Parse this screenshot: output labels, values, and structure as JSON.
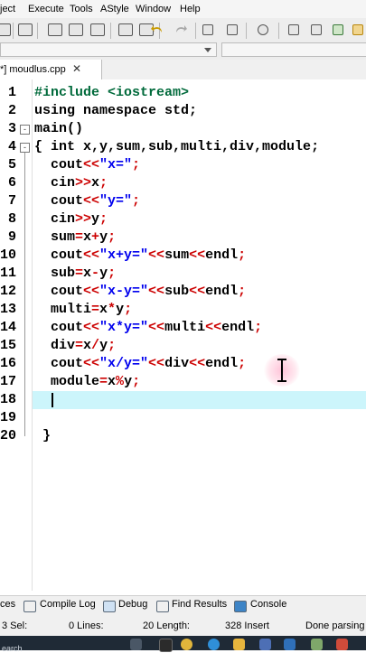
{
  "menu": {
    "items": [
      "ject",
      "Execute",
      "Tools",
      "AStyle",
      "Window",
      "Help"
    ]
  },
  "tab": {
    "label": "*] moudlus.cpp",
    "close": "✕"
  },
  "editor": {
    "line_numbers": [
      "1",
      "2",
      "3",
      "4",
      "5",
      "6",
      "7",
      "8",
      "9",
      "10",
      "11",
      "12",
      "13",
      "14",
      "15",
      "16",
      "17",
      "18",
      "19",
      "20"
    ],
    "lines": [
      [
        {
          "t": "#include <iostream>",
          "c": "pp"
        }
      ],
      [
        {
          "t": "using namespace std;",
          "c": "k"
        }
      ],
      [
        {
          "t": "main()",
          "c": "k"
        }
      ],
      [
        {
          "t": "{ ",
          "c": "k"
        },
        {
          "t": "int x,y,sum,sub,multi,div,module;",
          "c": "k"
        }
      ],
      [
        {
          "t": "  cout",
          "c": "k"
        },
        {
          "t": "<<",
          "c": "o"
        },
        {
          "t": "\"x=\"",
          "c": "s"
        },
        {
          "t": ";",
          "c": "o"
        }
      ],
      [
        {
          "t": "  cin",
          "c": "k"
        },
        {
          "t": ">>",
          "c": "o"
        },
        {
          "t": "x",
          "c": "k"
        },
        {
          "t": ";",
          "c": "o"
        }
      ],
      [
        {
          "t": "  cout",
          "c": "k"
        },
        {
          "t": "<<",
          "c": "o"
        },
        {
          "t": "\"y=\"",
          "c": "s"
        },
        {
          "t": ";",
          "c": "o"
        }
      ],
      [
        {
          "t": "  cin",
          "c": "k"
        },
        {
          "t": ">>",
          "c": "o"
        },
        {
          "t": "y",
          "c": "k"
        },
        {
          "t": ";",
          "c": "o"
        }
      ],
      [
        {
          "t": "  sum",
          "c": "k"
        },
        {
          "t": "=",
          "c": "o"
        },
        {
          "t": "x",
          "c": "k"
        },
        {
          "t": "+",
          "c": "o"
        },
        {
          "t": "y",
          "c": "k"
        },
        {
          "t": ";",
          "c": "o"
        }
      ],
      [
        {
          "t": "  cout",
          "c": "k"
        },
        {
          "t": "<<",
          "c": "o"
        },
        {
          "t": "\"x+y=\"",
          "c": "s"
        },
        {
          "t": "<<",
          "c": "o"
        },
        {
          "t": "sum",
          "c": "k"
        },
        {
          "t": "<<",
          "c": "o"
        },
        {
          "t": "endl",
          "c": "k"
        },
        {
          "t": ";",
          "c": "o"
        }
      ],
      [
        {
          "t": "  sub",
          "c": "k"
        },
        {
          "t": "=",
          "c": "o"
        },
        {
          "t": "x",
          "c": "k"
        },
        {
          "t": "-",
          "c": "o"
        },
        {
          "t": "y",
          "c": "k"
        },
        {
          "t": ";",
          "c": "o"
        }
      ],
      [
        {
          "t": "  cout",
          "c": "k"
        },
        {
          "t": "<<",
          "c": "o"
        },
        {
          "t": "\"x-y=\"",
          "c": "s"
        },
        {
          "t": "<<",
          "c": "o"
        },
        {
          "t": "sub",
          "c": "k"
        },
        {
          "t": "<<",
          "c": "o"
        },
        {
          "t": "endl",
          "c": "k"
        },
        {
          "t": ";",
          "c": "o"
        }
      ],
      [
        {
          "t": "  multi",
          "c": "k"
        },
        {
          "t": "=",
          "c": "o"
        },
        {
          "t": "x",
          "c": "k"
        },
        {
          "t": "*",
          "c": "o"
        },
        {
          "t": "y",
          "c": "k"
        },
        {
          "t": ";",
          "c": "o"
        }
      ],
      [
        {
          "t": "  cout",
          "c": "k"
        },
        {
          "t": "<<",
          "c": "o"
        },
        {
          "t": "\"x*y=\"",
          "c": "s"
        },
        {
          "t": "<<",
          "c": "o"
        },
        {
          "t": "multi",
          "c": "k"
        },
        {
          "t": "<<",
          "c": "o"
        },
        {
          "t": "endl",
          "c": "k"
        },
        {
          "t": ";",
          "c": "o"
        }
      ],
      [
        {
          "t": "  div",
          "c": "k"
        },
        {
          "t": "=",
          "c": "o"
        },
        {
          "t": "x",
          "c": "k"
        },
        {
          "t": "/",
          "c": "o"
        },
        {
          "t": "y",
          "c": "k"
        },
        {
          "t": ";",
          "c": "o"
        }
      ],
      [
        {
          "t": "  cout",
          "c": "k"
        },
        {
          "t": "<<",
          "c": "o"
        },
        {
          "t": "\"x/y=\"",
          "c": "s"
        },
        {
          "t": "<<",
          "c": "o"
        },
        {
          "t": "div",
          "c": "k"
        },
        {
          "t": "<<",
          "c": "o"
        },
        {
          "t": "endl",
          "c": "k"
        },
        {
          "t": ";",
          "c": "o"
        }
      ],
      [
        {
          "t": "  module",
          "c": "k"
        },
        {
          "t": "=",
          "c": "o"
        },
        {
          "t": "x",
          "c": "k"
        },
        {
          "t": "%",
          "c": "o"
        },
        {
          "t": "y",
          "c": "k"
        },
        {
          "t": ";",
          "c": "o"
        }
      ],
      [
        {
          "t": "",
          "c": "k"
        }
      ],
      [
        {
          "t": "",
          "c": "k"
        }
      ],
      [
        {
          "t": " }",
          "c": "k"
        }
      ]
    ],
    "active_line": 18
  },
  "bottom_tabs": [
    "ces",
    "Compile Log",
    "Debug",
    "Find Results",
    "Console"
  ],
  "status": {
    "sel": "3 Sel:",
    "lines": "0 Lines:",
    "length": "20 Length:",
    "insert": "328 Insert",
    "message": "Done parsing"
  },
  "taskbar": {
    "search": "earch"
  },
  "colors": {
    "preprocessor": "#006a3b",
    "string": "#0000ee",
    "operator": "#cc0000",
    "active_line": "#ccf5fb"
  }
}
